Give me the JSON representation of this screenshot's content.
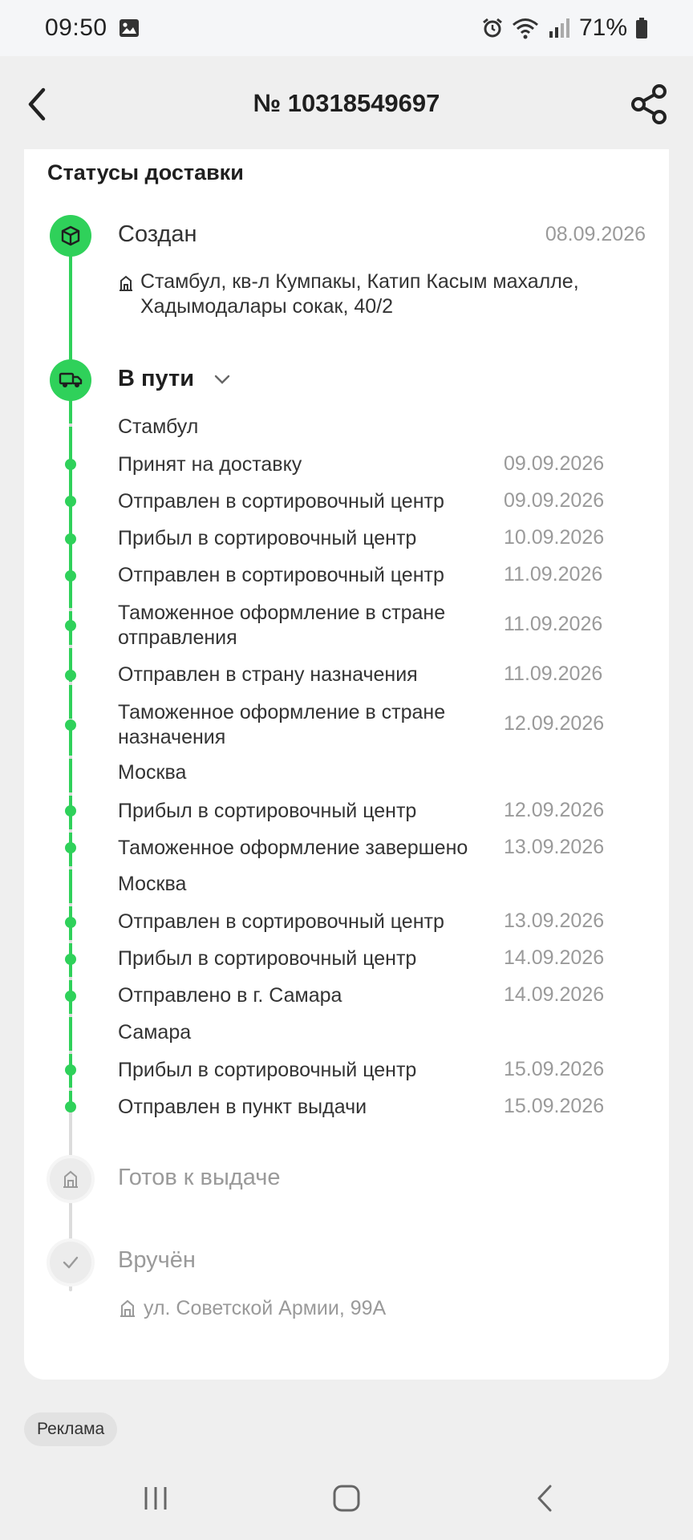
{
  "status_bar": {
    "time": "09:50",
    "battery": "71%",
    "icons": [
      "gallery-icon",
      "alarm-icon",
      "wifi-icon",
      "signal-icon",
      "battery-icon"
    ]
  },
  "header": {
    "title": "№ 10318549697",
    "back_icon": "back-icon",
    "share_icon": "share-icon"
  },
  "card": {
    "title": "Статусы доставки",
    "steps": {
      "created": {
        "label": "Создан",
        "date": "08.09.2026",
        "address": "Стамбул, кв-л Кумпакы, Катип Касым махалле, Хадымодалары сокак, 40/2",
        "icon": "box-icon"
      },
      "in_transit": {
        "label": "В пути",
        "icon": "truck-icon",
        "groups": [
          {
            "city": "Стамбул"
          },
          {
            "city": "Москва"
          },
          {
            "city": "Москва"
          },
          {
            "city": "Самара"
          }
        ],
        "events": [
          {
            "text": "Принят на доставку",
            "date": "09.09.2026"
          },
          {
            "text": "Отправлен в сортировочный центр",
            "date": "09.09.2026"
          },
          {
            "text": "Прибыл в сортировочный центр",
            "date": "10.09.2026"
          },
          {
            "text": "Отправлен в сортировочный центр",
            "date": "11.09.2026"
          },
          {
            "text": "Таможенное оформление в стране отправления",
            "date": "11.09.2026"
          },
          {
            "text": "Отправлен в страну назначения",
            "date": "11.09.2026"
          },
          {
            "text": "Таможенное оформление в стране назначения",
            "date": "12.09.2026"
          },
          {
            "text": "Прибыл в сортировочный центр",
            "date": "12.09.2026"
          },
          {
            "text": "Таможенное оформление завершено",
            "date": "13.09.2026"
          },
          {
            "text": "Отправлен в сортировочный центр",
            "date": "13.09.2026"
          },
          {
            "text": "Прибыл в сортировочный центр",
            "date": "14.09.2026"
          },
          {
            "text": "Отправлено в г. Самара",
            "date": "14.09.2026"
          },
          {
            "text": "Прибыл в сортировочный центр",
            "date": "15.09.2026"
          },
          {
            "text": "Отправлен в пункт выдачи",
            "date": "15.09.2026"
          }
        ]
      },
      "ready": {
        "label": "Готов к выдаче",
        "icon": "building-icon"
      },
      "delivered": {
        "label": "Вручён",
        "icon": "check-icon",
        "address": "ул. Советской Армии, 99А"
      }
    }
  },
  "ad_badge": "Реклама",
  "colors": {
    "accent_green": "#2fd15a",
    "muted_text": "#9a9a9a",
    "background": "#efefef"
  },
  "nav": {
    "recent_icon": "recent-apps-icon",
    "home_icon": "home-icon",
    "back_icon": "nav-back-icon"
  }
}
